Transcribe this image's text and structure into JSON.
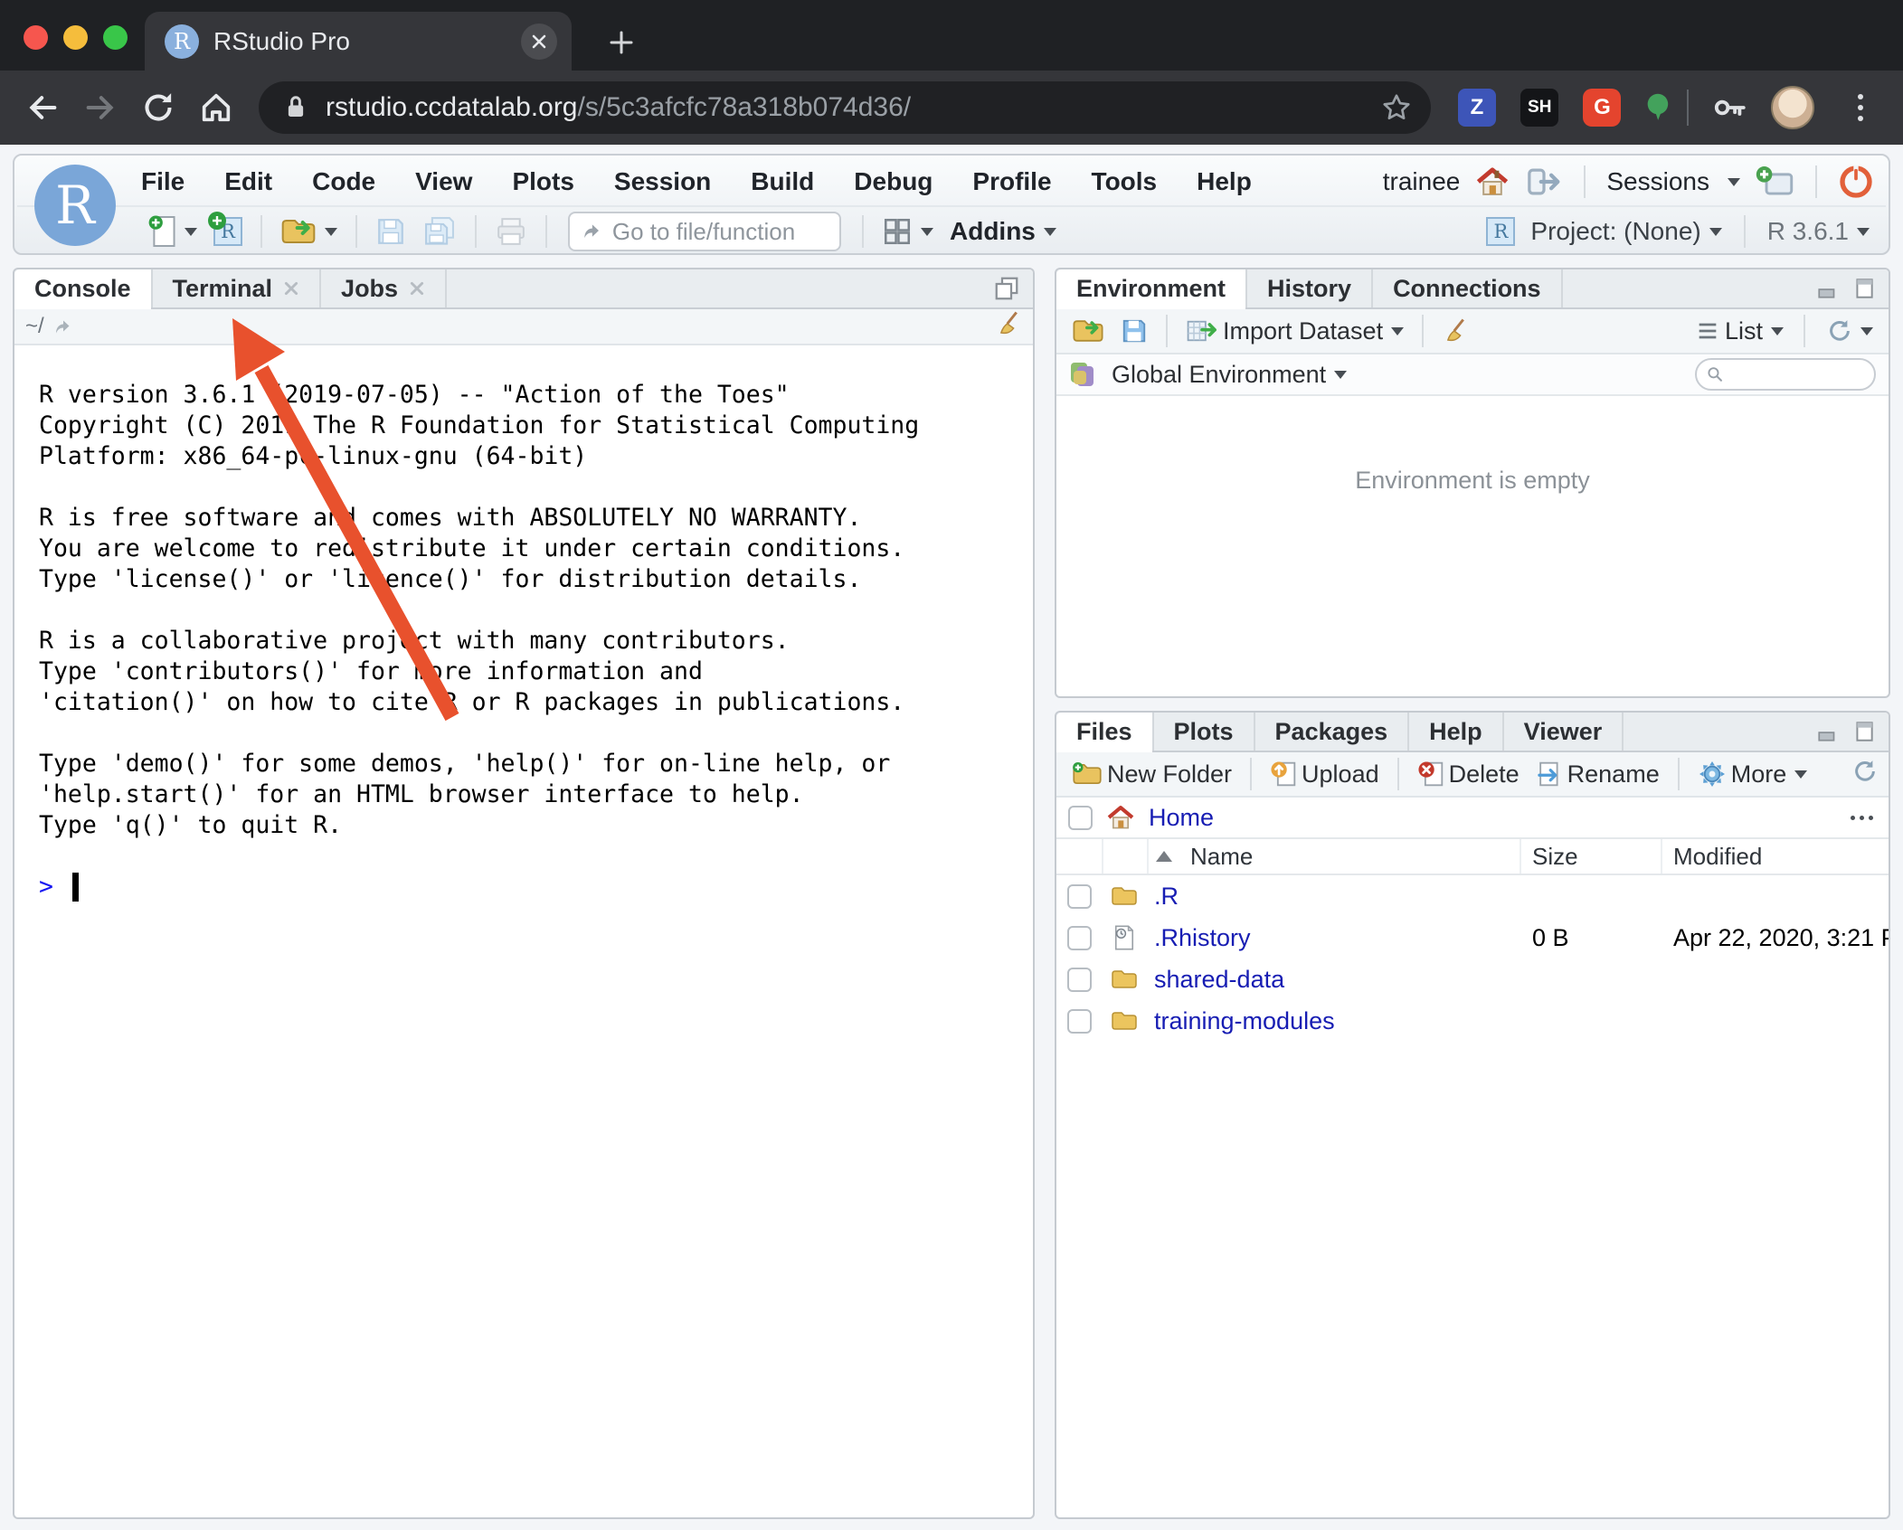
{
  "icons": {
    "r_letter": "R",
    "zotero": "Z",
    "sh": "SH",
    "grammarly": "G"
  },
  "browser": {
    "tab_title": "RStudio Pro",
    "url_domain": "rstudio.ccdatalab.org",
    "url_path": "/s/5c3afcfc78a318b074d36/"
  },
  "menubar": {
    "items": [
      "File",
      "Edit",
      "Code",
      "View",
      "Plots",
      "Session",
      "Build",
      "Debug",
      "Profile",
      "Tools",
      "Help"
    ],
    "user": "trainee",
    "sessions_label": "Sessions"
  },
  "toolbar": {
    "goto_placeholder": "Go to file/function",
    "addins_label": "Addins",
    "project_label": "Project: (None)",
    "r_version": "R 3.6.1"
  },
  "console": {
    "tabs": [
      "Console",
      "Terminal",
      "Jobs"
    ],
    "path": "~/",
    "prompt": ">",
    "lines": [
      "R version 3.6.1 (2019-07-05) -- \"Action of the Toes\"",
      "Copyright (C) 2019 The R Foundation for Statistical Computing",
      "Platform: x86_64-pc-linux-gnu (64-bit)",
      "",
      "R is free software and comes with ABSOLUTELY NO WARRANTY.",
      "You are welcome to redistribute it under certain conditions.",
      "Type 'license()' or 'licence()' for distribution details.",
      "",
      "R is a collaborative project with many contributors.",
      "Type 'contributors()' for more information and",
      "'citation()' on how to cite R or R packages in publications.",
      "",
      "Type 'demo()' for some demos, 'help()' for on-line help, or",
      "'help.start()' for an HTML browser interface to help.",
      "Type 'q()' to quit R."
    ]
  },
  "environment": {
    "tabs": [
      "Environment",
      "History",
      "Connections"
    ],
    "import_label": "Import Dataset",
    "list_label": "List",
    "scope_label": "Global Environment",
    "empty_text": "Environment is empty"
  },
  "files": {
    "tabs": [
      "Files",
      "Plots",
      "Packages",
      "Help",
      "Viewer"
    ],
    "actions": {
      "new_folder": "New Folder",
      "upload": "Upload",
      "delete": "Delete",
      "rename": "Rename",
      "more": "More"
    },
    "breadcrumb_home": "Home",
    "columns": {
      "name": "Name",
      "size": "Size",
      "modified": "Modified"
    },
    "rows": [
      {
        "name": ".R",
        "size": "",
        "modified": ""
      },
      {
        "name": ".Rhistory",
        "size": "0 B",
        "modified": "Apr 22, 2020, 3:21 P"
      },
      {
        "name": "shared-data",
        "size": "",
        "modified": ""
      },
      {
        "name": "training-modules",
        "size": "",
        "modified": ""
      }
    ]
  }
}
